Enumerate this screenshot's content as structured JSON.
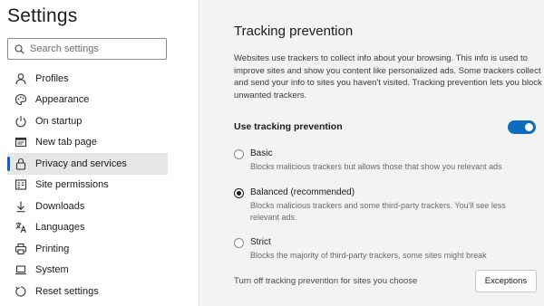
{
  "sidebar": {
    "title": "Settings",
    "search": {
      "placeholder": "Search settings",
      "value": ""
    },
    "items": [
      {
        "label": "Profiles",
        "icon": "person-icon"
      },
      {
        "label": "Appearance",
        "icon": "palette-icon"
      },
      {
        "label": "On startup",
        "icon": "power-icon"
      },
      {
        "label": "New tab page",
        "icon": "new-tab-icon"
      },
      {
        "label": "Privacy and services",
        "icon": "lock-icon",
        "selected": true
      },
      {
        "label": "Site permissions",
        "icon": "site-permissions-icon"
      },
      {
        "label": "Downloads",
        "icon": "download-icon"
      },
      {
        "label": "Languages",
        "icon": "languages-icon"
      },
      {
        "label": "Printing",
        "icon": "printer-icon"
      },
      {
        "label": "System",
        "icon": "laptop-icon"
      },
      {
        "label": "Reset settings",
        "icon": "reset-icon"
      }
    ]
  },
  "main": {
    "title": "Tracking prevention",
    "description": "Websites use trackers to collect info about your browsing. This info is used to improve sites and show you content like personalized ads. Some trackers collect and send your info to sites you haven't visited. Tracking prevention lets you block unwanted trackers.",
    "toggle": {
      "label": "Use tracking prevention",
      "on": true
    },
    "options": [
      {
        "title": "Basic",
        "description": "Blocks malicious trackers but allows those that show you relevant ads",
        "checked": false
      },
      {
        "title": "Balanced (recommended)",
        "description": "Blocks malicious trackers and some third-party trackers. You'll see less relevant ads.",
        "checked": true
      },
      {
        "title": "Strict",
        "description": "Blocks the majority of third-party trackers, some sites might break",
        "checked": false
      }
    ],
    "footer_text": "Turn off tracking prevention for sites you choose",
    "exceptions_label": "Exceptions"
  },
  "colors": {
    "accent": "#0f6cbd",
    "sidebar_background": "#ffffff",
    "main_background": "#f3f3f3",
    "selected_item_background": "#e6e6e6"
  }
}
